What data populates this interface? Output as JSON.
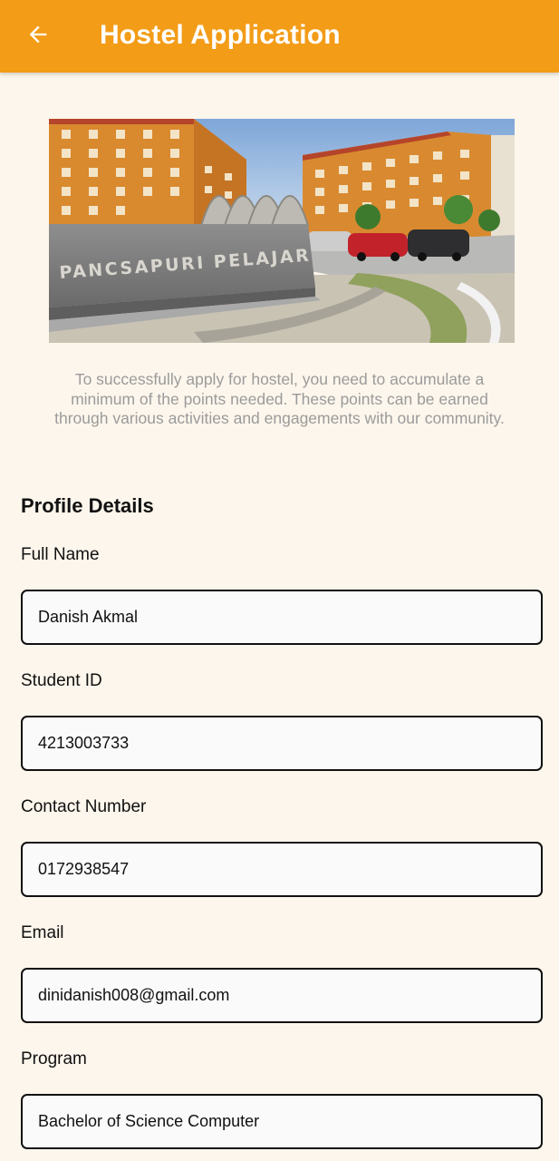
{
  "app_bar": {
    "title": "Hostel Application",
    "back_icon": "arrow-left-icon",
    "background_color": "#F39C17"
  },
  "hero": {
    "sign_text": "PANCSAPURI PELAJAR"
  },
  "intro": {
    "text": "To successfully apply for hostel, you need to accumulate a minimum of the points needed. These points can be earned through various activities and engagements with our community."
  },
  "profile": {
    "section_title": "Profile Details",
    "fields": [
      {
        "label": "Full Name",
        "value": "Danish Akmal"
      },
      {
        "label": "Student ID",
        "value": "4213003733"
      },
      {
        "label": "Contact Number",
        "value": "0172938547"
      },
      {
        "label": "Email",
        "value": "dinidanish008@gmail.com"
      },
      {
        "label": "Program",
        "value": "Bachelor of Science Computer"
      }
    ]
  },
  "colors": {
    "page_background": "#FDF6EC",
    "accent": "#F39C17",
    "input_border": "#111111",
    "input_background": "#FAFAFA"
  }
}
